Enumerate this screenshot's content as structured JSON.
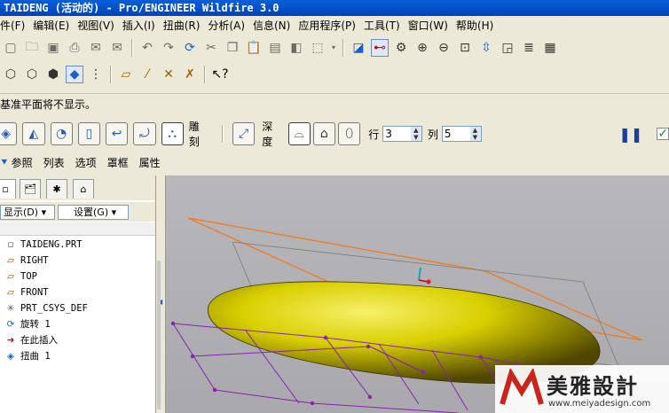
{
  "window": {
    "title": "TAIDENG (活动的) - Pro/ENGINEER Wildfire 3.0"
  },
  "menu": [
    "件(F)",
    "编辑(E)",
    "视图(V)",
    "插入(I)",
    "扭曲(R)",
    "分析(A)",
    "信息(N)",
    "应用程序(P)",
    "工具(T)",
    "窗口(W)",
    "帮助(H)"
  ],
  "message": "基准平面将不显示。",
  "dashboard": {
    "carve_label": "雕刻",
    "depth_label": "深度",
    "rows_label": "行",
    "rows_value": "3",
    "cols_label": "列",
    "cols_value": "5"
  },
  "dashboard_tabs": [
    "参照",
    "列表",
    "选项",
    "罩框",
    "属性"
  ],
  "panel": {
    "show_dropdown": "显示(D)",
    "settings_dropdown": "设置(G)"
  },
  "model_tree": [
    {
      "icon": "part-icon",
      "label": "TAIDENG.PRT"
    },
    {
      "icon": "datum-plane-icon",
      "label": "RIGHT"
    },
    {
      "icon": "datum-plane-icon",
      "label": "TOP"
    },
    {
      "icon": "datum-plane-icon",
      "label": "FRONT"
    },
    {
      "icon": "csys-icon",
      "label": "PRT_CSYS_DEF"
    },
    {
      "icon": "revolve-icon",
      "label": "旋转 1"
    },
    {
      "icon": "insert-here-icon",
      "label": "在此插入"
    },
    {
      "icon": "warp-icon",
      "label": "扭曲 1"
    }
  ],
  "watermark": {
    "brand": "美雅設計",
    "url": "www.meiyadesign.com"
  },
  "colors": {
    "titlebar": "#0a5fd8",
    "model": "#c8c000",
    "lattice": "#8a1fb0",
    "bbox_orange": "#f07a1a"
  }
}
